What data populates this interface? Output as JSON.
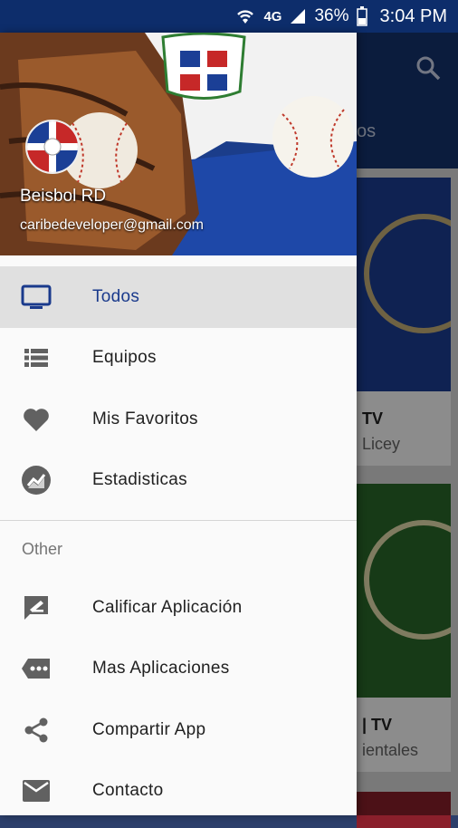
{
  "status_bar": {
    "network": "4G",
    "battery": "36%",
    "time": "3:04 PM"
  },
  "background_app": {
    "tab_fragment": "os",
    "cards": [
      {
        "title_fragment": "TV",
        "subtitle_fragment": "Licey",
        "color": "#1d3f96"
      },
      {
        "title_fragment": "| TV",
        "subtitle_fragment": "ientales",
        "color": "#2b6a2b"
      },
      {
        "title_fragment": "",
        "subtitle_fragment": "",
        "color": "#8a1f2b"
      }
    ]
  },
  "drawer": {
    "header": {
      "app_name": "Beisbol RD",
      "email": "caribedeveloper@gmail.com"
    },
    "items": [
      {
        "label": "Todos",
        "icon": "tv-icon",
        "active": true
      },
      {
        "label": "Equipos",
        "icon": "list-icon",
        "active": false
      },
      {
        "label": "Mis Favoritos",
        "icon": "heart-icon",
        "active": false
      },
      {
        "label": "Estadisticas",
        "icon": "stats-icon",
        "active": false
      }
    ],
    "section_title": "Other",
    "other_items": [
      {
        "label": "Calificar Aplicación",
        "icon": "rate-icon"
      },
      {
        "label": "Mas Aplicaciones",
        "icon": "more-apps-icon"
      },
      {
        "label": "Compartir App",
        "icon": "share-icon"
      },
      {
        "label": "Contacto",
        "icon": "mail-icon"
      }
    ]
  },
  "colors": {
    "primary": "#14336f",
    "active_text": "#1a3a8c",
    "icon_gray": "#616161"
  }
}
